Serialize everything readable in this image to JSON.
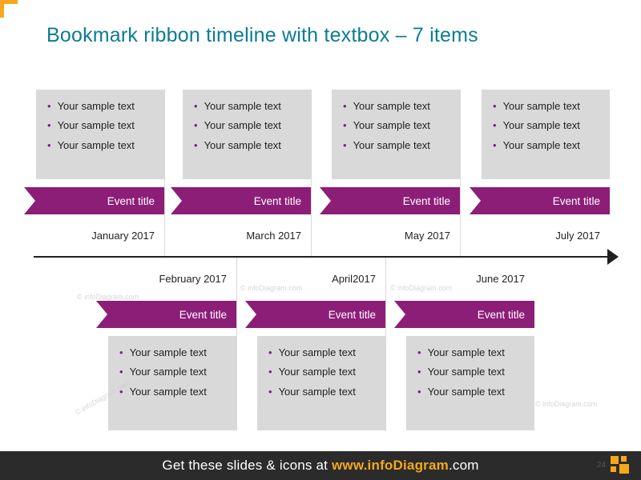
{
  "slide": {
    "title": "Bookmark ribbon timeline with textbox – 7 items",
    "accent_color": "#f5a81c",
    "ribbon_color": "#8c1e78",
    "title_color": "#0b7c96",
    "textbox_color": "#d9d9d9"
  },
  "upper_items": [
    {
      "ribbon_label": "Event title",
      "date": "January 2017",
      "bullets": [
        "Your sample text",
        "Your sample text",
        "Your sample text"
      ]
    },
    {
      "ribbon_label": "Event title",
      "date": "March 2017",
      "bullets": [
        "Your sample text",
        "Your sample text",
        "Your sample text"
      ]
    },
    {
      "ribbon_label": "Event title",
      "date": "May 2017",
      "bullets": [
        "Your sample text",
        "Your sample text",
        "Your sample text"
      ]
    },
    {
      "ribbon_label": "Event title",
      "date": "July 2017",
      "bullets": [
        "Your sample text",
        "Your sample text",
        "Your sample text"
      ]
    }
  ],
  "lower_items": [
    {
      "ribbon_label": "Event title",
      "date": "February 2017",
      "bullets": [
        "Your sample text",
        "Your sample text",
        "Your sample text"
      ]
    },
    {
      "ribbon_label": "Event title",
      "date": "April2017",
      "bullets": [
        "Your sample text",
        "Your sample text",
        "Your sample text"
      ]
    },
    {
      "ribbon_label": "Event title",
      "date": "June 2017",
      "bullets": [
        "Your sample text",
        "Your sample text",
        "Your sample text"
      ]
    }
  ],
  "watermarks": [
    "© infoDiagram.com",
    "© infoDiagram.com",
    "© infoDiagram.com",
    "© infoDiagram.com",
    "© infoDiagram.com"
  ],
  "footer": {
    "text_before": "Get these slides & icons at ",
    "brand": "www.infoDiagram",
    "text_after": ".com",
    "page_number": "24"
  }
}
